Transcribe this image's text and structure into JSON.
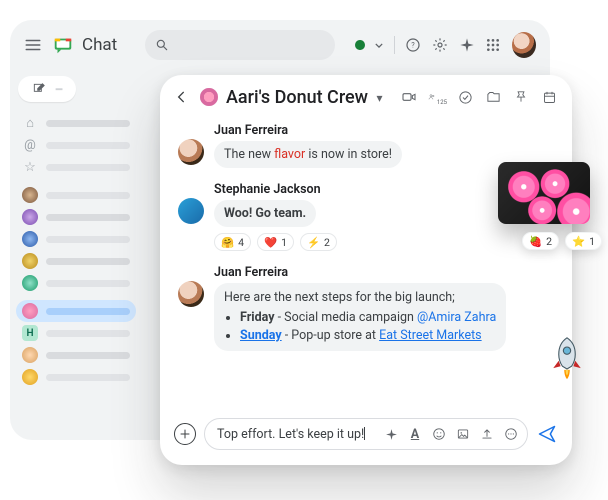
{
  "app": {
    "name": "Chat"
  },
  "header": {
    "status": "active",
    "avatar_alt": "User avatar"
  },
  "room": {
    "title": "Aari's Donut Crew",
    "member_badge": "125"
  },
  "messages": [
    {
      "author": "Juan Ferreira",
      "prefix": "The new ",
      "highlight": "flavor",
      "suffix": " is now in store!"
    },
    {
      "author": "Stephanie Jackson",
      "text": "Woo! Go team.",
      "reactions": [
        {
          "emoji": "🤗",
          "count": "4"
        },
        {
          "emoji": "❤️",
          "count": "1"
        },
        {
          "emoji": "⚡",
          "count": "2"
        }
      ]
    },
    {
      "author": "Juan Ferreira",
      "intro": "Here are the next steps for the big launch;",
      "items": [
        {
          "day": "Friday",
          "tail": " - Social media campaign ",
          "mention": "@Amira Zahra",
          "link": ""
        },
        {
          "day": "Sunday",
          "tail": " - Pop-up store at ",
          "mention": "",
          "link": "Eat Street Markets"
        }
      ]
    }
  ],
  "composer": {
    "text": "Top effort. Let's keep it up!"
  },
  "overlay_reactions": [
    {
      "emoji": "🍓",
      "count": "2"
    },
    {
      "emoji": "⭐",
      "count": "1"
    }
  ],
  "icons": {
    "menu": "≡",
    "search": "⌕",
    "status_caret": "▾",
    "help": "?",
    "settings": "⚙",
    "gemini": "✦",
    "apps": "⋮⋮⋮",
    "compose": "✎",
    "back": "←",
    "video": "⧉",
    "people": "⛭",
    "tasks": "✓",
    "files": "▭",
    "pin": "⧖",
    "calendar": "▦",
    "plus": "+",
    "format": "A",
    "emoji": "☺",
    "image": "▭",
    "upload": "⤒",
    "more": "⊙",
    "send": "➤"
  }
}
